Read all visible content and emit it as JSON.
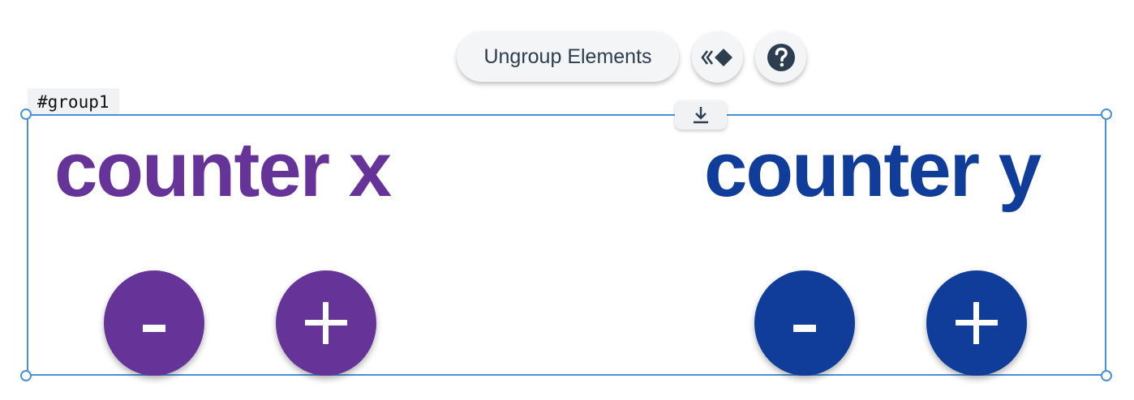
{
  "toolbar": {
    "ungroup_label": "Ungroup Elements",
    "elements_icon": "elements-icon",
    "help_icon": "question-circle-icon"
  },
  "group": {
    "label": "#group1",
    "download_icon": "download-icon"
  },
  "counters": [
    {
      "title": "counter x",
      "color": "#663399",
      "decrement_label": "-",
      "increment_label": "+"
    },
    {
      "title": "counter y",
      "color": "#0f3d99",
      "decrement_label": "-",
      "increment_label": "+"
    }
  ],
  "colors": {
    "selection": "#4a90d9",
    "toolbar_text": "#2c3e50"
  }
}
